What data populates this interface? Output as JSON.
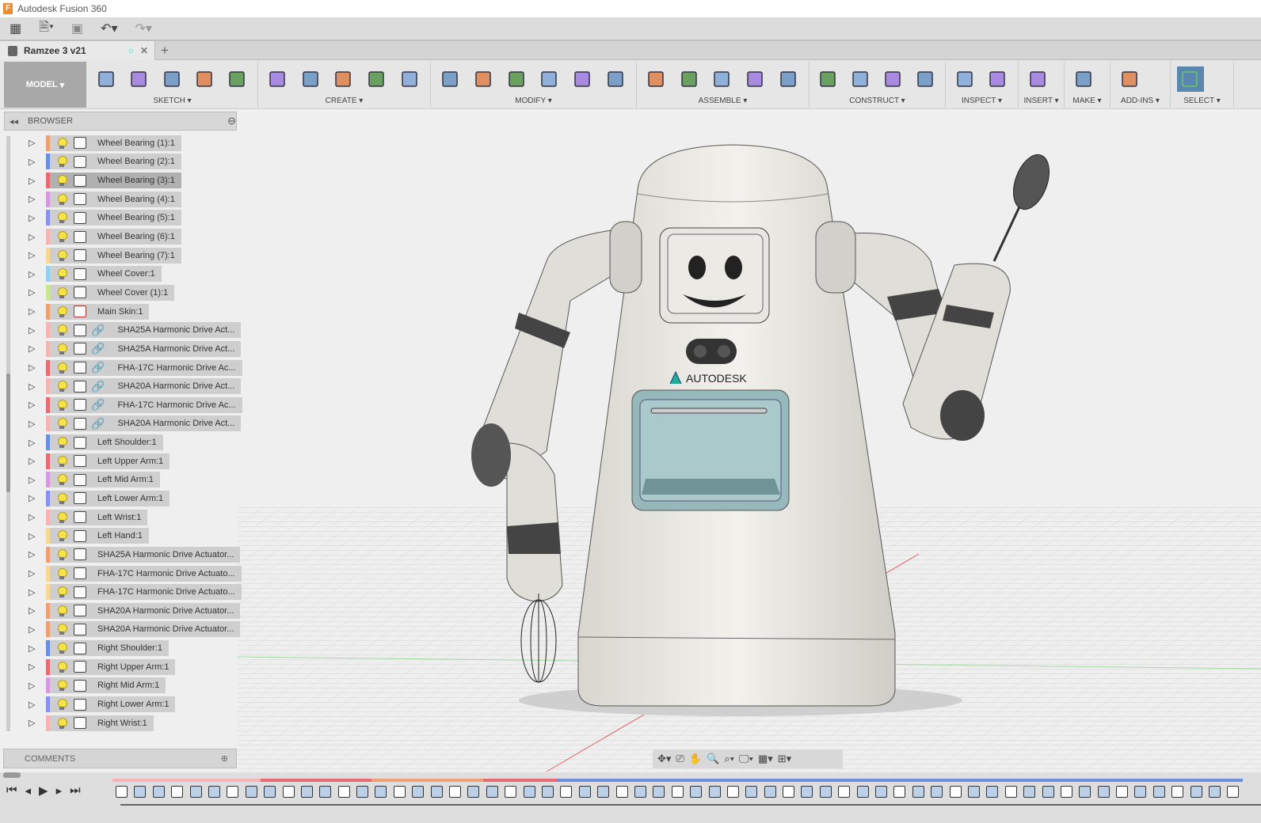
{
  "app": {
    "title": "Autodesk Fusion 360"
  },
  "document_tab": {
    "name": "Ramzee 3 v21"
  },
  "workspace": {
    "label": "MODEL"
  },
  "ribbon": {
    "groups": [
      {
        "label": "SKETCH",
        "icons": [
          "create-sketch-icon",
          "line-icon",
          "rectangle-icon",
          "spline-icon",
          "project-icon"
        ]
      },
      {
        "label": "CREATE",
        "icons": [
          "extrude-icon",
          "form-icon",
          "revolve-icon",
          "mirror-icon",
          "loft-icon"
        ]
      },
      {
        "label": "MODIFY",
        "icons": [
          "press-pull-icon",
          "fillet-icon",
          "combine-icon",
          "offset-face-icon",
          "split-body-icon",
          "sigma-icon"
        ]
      },
      {
        "label": "ASSEMBLE",
        "icons": [
          "new-component-icon",
          "joint-icon",
          "as-built-joint-icon",
          "rigid-group-icon",
          "motion-link-icon"
        ]
      },
      {
        "label": "CONSTRUCT",
        "icons": [
          "offset-plane-icon",
          "plane-at-angle-icon",
          "midplane-icon",
          "axis-icon"
        ]
      },
      {
        "label": "INSPECT",
        "icons": [
          "measure-icon",
          "section-analysis-icon"
        ]
      },
      {
        "label": "INSERT",
        "icons": [
          "insert-image-icon"
        ]
      },
      {
        "label": "MAKE",
        "icons": [
          "3d-print-icon"
        ]
      },
      {
        "label": "ADD-INS",
        "icons": [
          "scripts-icon"
        ]
      },
      {
        "label": "SELECT",
        "icons": [
          "select-icon"
        ]
      }
    ]
  },
  "browser": {
    "title": "BROWSER",
    "items": [
      {
        "label": "Wheel Bearing (1):1",
        "color": "#f0a070",
        "type": "body"
      },
      {
        "label": "Wheel Bearing (2):1",
        "color": "#6a8ee0",
        "type": "body"
      },
      {
        "label": "Wheel Bearing (3):1",
        "color": "#e86a72",
        "type": "body",
        "selected": true
      },
      {
        "label": "Wheel Bearing (4):1",
        "color": "#d898e0",
        "type": "body"
      },
      {
        "label": "Wheel Bearing (5):1",
        "color": "#8a90f0",
        "type": "body"
      },
      {
        "label": "Wheel Bearing (6):1",
        "color": "#f8b4b4",
        "type": "body"
      },
      {
        "label": "Wheel Bearing (7):1",
        "color": "#f8d890",
        "type": "body"
      },
      {
        "label": "Wheel Cover:1",
        "color": "#90d0f0",
        "type": "body"
      },
      {
        "label": "Wheel Cover (1):1",
        "color": "#c8e890",
        "type": "body"
      },
      {
        "label": "Main Skin:1",
        "color": "#f0a070",
        "type": "pinned"
      },
      {
        "label": "SHA25A Harmonic Drive Act...",
        "color": "#f8b4b4",
        "type": "linked"
      },
      {
        "label": "SHA25A Harmonic Drive Act...",
        "color": "#f8b4b4",
        "type": "linked"
      },
      {
        "label": "FHA-17C Harmonic Drive Ac...",
        "color": "#e86a72",
        "type": "linked"
      },
      {
        "label": "SHA20A Harmonic Drive Act...",
        "color": "#f8b4b4",
        "type": "linked"
      },
      {
        "label": "FHA-17C Harmonic Drive Ac...",
        "color": "#e86a72",
        "type": "linked"
      },
      {
        "label": "SHA20A Harmonic Drive Act...",
        "color": "#f8b4b4",
        "type": "linked"
      },
      {
        "label": "Left Shoulder:1",
        "color": "#6a8ee0",
        "type": "body"
      },
      {
        "label": "Left Upper Arm:1",
        "color": "#e86a72",
        "type": "body"
      },
      {
        "label": "Left Mid Arm:1",
        "color": "#d898e0",
        "type": "body"
      },
      {
        "label": "Left Lower Arm:1",
        "color": "#8a90f0",
        "type": "body"
      },
      {
        "label": "Left Wrist:1",
        "color": "#f8b4b4",
        "type": "body"
      },
      {
        "label": "Left Hand:1",
        "color": "#f8d890",
        "type": "body"
      },
      {
        "label": "SHA25A Harmonic Drive Actuator...",
        "color": "#f0a070",
        "type": "assembly"
      },
      {
        "label": "FHA-17C Harmonic Drive Actuato...",
        "color": "#f8d890",
        "type": "assembly"
      },
      {
        "label": "FHA-17C Harmonic Drive Actuato...",
        "color": "#f8d890",
        "type": "assembly"
      },
      {
        "label": "SHA20A Harmonic Drive Actuator...",
        "color": "#f0a070",
        "type": "assembly"
      },
      {
        "label": "SHA20A Harmonic Drive Actuator...",
        "color": "#f0a070",
        "type": "assembly"
      },
      {
        "label": "Right Shoulder:1",
        "color": "#6a8ee0",
        "type": "body"
      },
      {
        "label": "Right Upper Arm:1",
        "color": "#e86a72",
        "type": "body"
      },
      {
        "label": "Right Mid Arm:1",
        "color": "#d898e0",
        "type": "body"
      },
      {
        "label": "Right Lower Arm:1",
        "color": "#8a90f0",
        "type": "body"
      },
      {
        "label": "Right Wrist:1",
        "color": "#f8b4b4",
        "type": "body"
      }
    ]
  },
  "comments": {
    "title": "COMMENTS"
  },
  "viewport": {
    "brand_text": "AUTODESK"
  },
  "timeline": {
    "band_colors": [
      "#f8b4b4",
      "#e86a72",
      "#f0a070",
      "#6a8ee0"
    ],
    "feature_count": 61
  }
}
